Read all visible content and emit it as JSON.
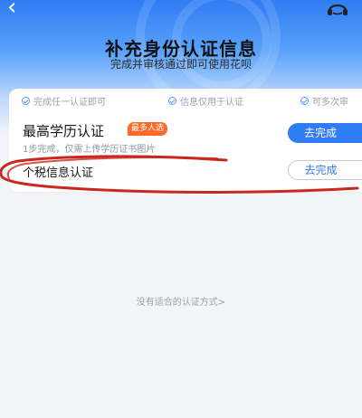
{
  "header": {
    "title": "补充身份认证信息",
    "subtitle": "完成并审核通过即可使用花呗"
  },
  "features": [
    {
      "label": "完成任一认证即可"
    },
    {
      "label": "信息仅用于认证"
    },
    {
      "label": "可多次审"
    }
  ],
  "items": [
    {
      "title": "最高学历认证",
      "badge": "最多人选",
      "description": "1步完成，仅需上传学历证书图片",
      "button": "去完成"
    },
    {
      "title": "个税信息认证",
      "button": "去完成"
    }
  ],
  "footer": {
    "link": "没有适合的认证方式>"
  },
  "colors": {
    "accent": "#2f7cf4",
    "badge": "#ff6a2a",
    "annotation": "#c9281f"
  },
  "icons": {
    "back": "back-arrow-icon",
    "support": "headset-icon"
  }
}
